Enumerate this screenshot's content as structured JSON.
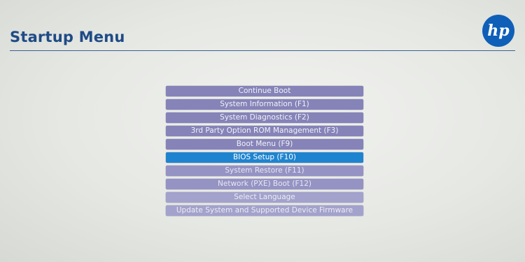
{
  "header": {
    "title": "Startup Menu",
    "logo_text": "hp",
    "accent_color": "#1f4b86"
  },
  "menu": {
    "selected_index": 5,
    "items": [
      {
        "label": "Continue Boot"
      },
      {
        "label": "System Information (F1)"
      },
      {
        "label": "System Diagnostics (F2)"
      },
      {
        "label": "3rd Party Option ROM Management (F3)"
      },
      {
        "label": "Boot Menu (F9)"
      },
      {
        "label": "BIOS Setup (F10)"
      },
      {
        "label": "System Restore (F11)"
      },
      {
        "label": "Network (PXE) Boot (F12)"
      },
      {
        "label": "Select Language"
      },
      {
        "label": "Update System and Supported Device Firmware"
      }
    ],
    "item_color": "#8583b8",
    "selected_color": "#1f84cf"
  }
}
